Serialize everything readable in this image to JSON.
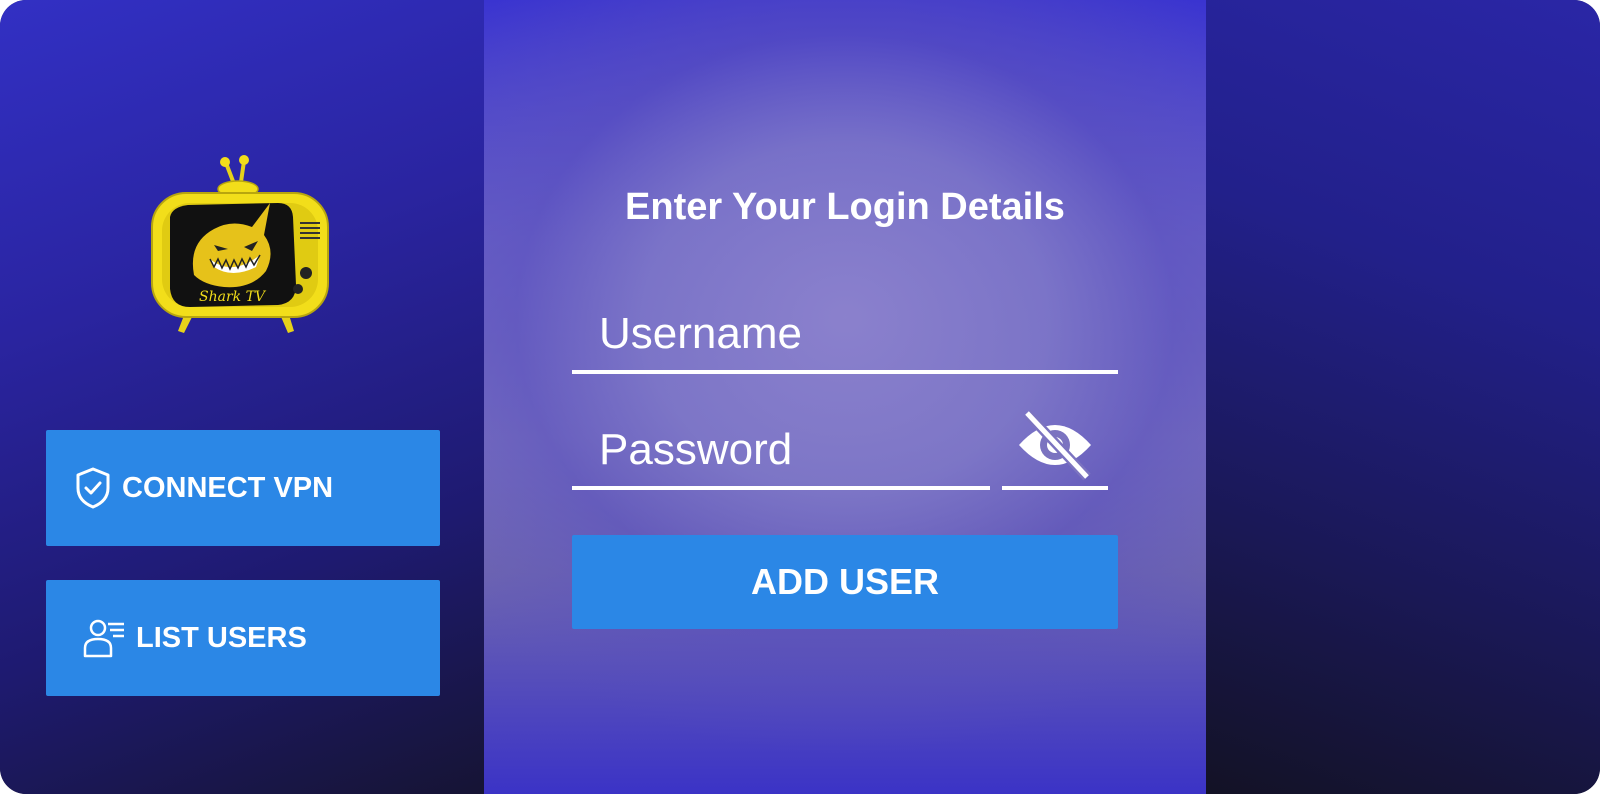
{
  "app": {
    "brand_text": "Shark TV"
  },
  "sidebar": {
    "connect_vpn_label": "CONNECT VPN",
    "connect_vpn_icon": "shield-check-icon",
    "list_users_label": "LIST USERS",
    "list_users_icon": "user-list-icon"
  },
  "login": {
    "title": "Enter Your Login Details",
    "username_placeholder": "Username",
    "password_placeholder": "Password",
    "toggle_visibility_icon": "eye-off-icon",
    "add_user_label": "ADD USER"
  },
  "colors": {
    "button": "#2b87e6",
    "logo_yellow": "#f2de1a",
    "background": "#2a26a6"
  }
}
